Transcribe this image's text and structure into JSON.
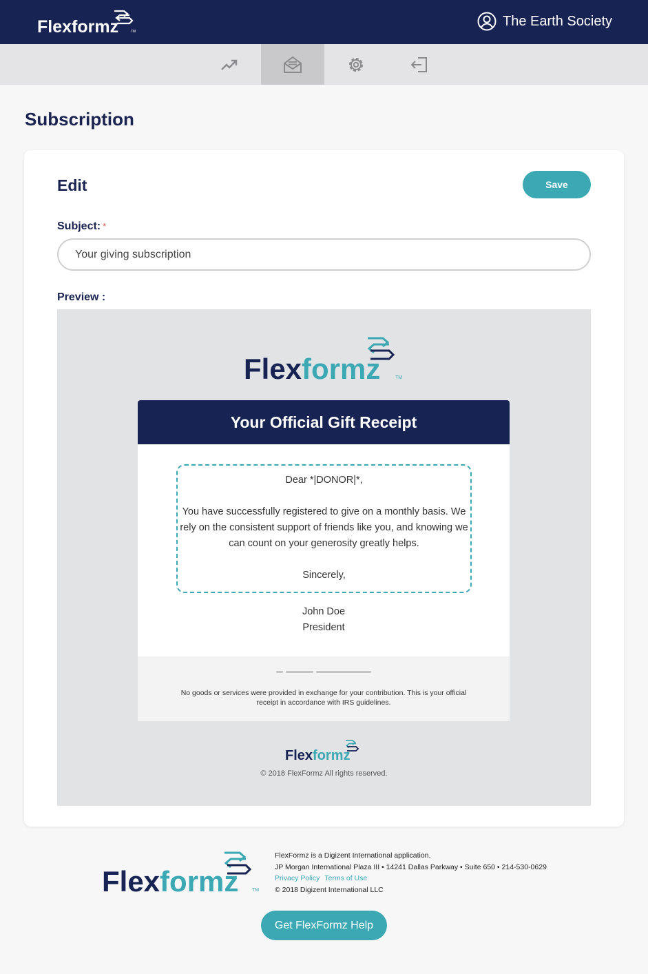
{
  "header": {
    "brand": {
      "part1": "Flex",
      "part2": "formz",
      "tm": "TM"
    },
    "user_name": "The Earth Society"
  },
  "nav": {
    "items": [
      {
        "icon": "trending-up-icon"
      },
      {
        "icon": "envelope-open-icon",
        "active": true
      },
      {
        "icon": "gear-icon"
      },
      {
        "icon": "logout-icon"
      }
    ]
  },
  "page": {
    "title": "Subscription"
  },
  "editor": {
    "title": "Edit",
    "save_label": "Save",
    "subject_label": "Subject:",
    "required_mark": "*",
    "subject_value": "Your giving subscription",
    "preview_label": "Preview :"
  },
  "preview": {
    "brand": {
      "part1": "Flex",
      "part2": "formz",
      "tm": "TM"
    },
    "receipt_title": "Your Official Gift Receipt",
    "greeting": "Dear *|DONOR|*,",
    "body": "You have successfully registered to give on a monthly basis. We rely on the consistent support of friends like you, and knowing we can count on your generosity greatly helps.",
    "closing": "Sincerely,",
    "signer_name": "John Doe",
    "signer_title": "President",
    "footer_note": "No goods or services were provided in exchange for your contribution. This is your official receipt in accordance with IRS guidelines.",
    "copyright": "© 2018 FlexFormz All rights reserved."
  },
  "footer": {
    "brand": {
      "part1": "Flex",
      "part2": "formz",
      "tm": "TM"
    },
    "line1": "FlexFormz is a Digizent International application.",
    "line2": "JP Morgan International Plaza III • 14241 Dallas Parkway • Suite 650 • 214-530-0629",
    "privacy_link": "Privacy Policy",
    "terms_link": "Terms of Use",
    "copyright": "© 2018 Digizent International LLC",
    "help_button": "Get FlexFormz Help"
  },
  "colors": {
    "navy": "#172352",
    "teal": "#3ba8b3",
    "preview_bg": "#e2e3e5"
  }
}
